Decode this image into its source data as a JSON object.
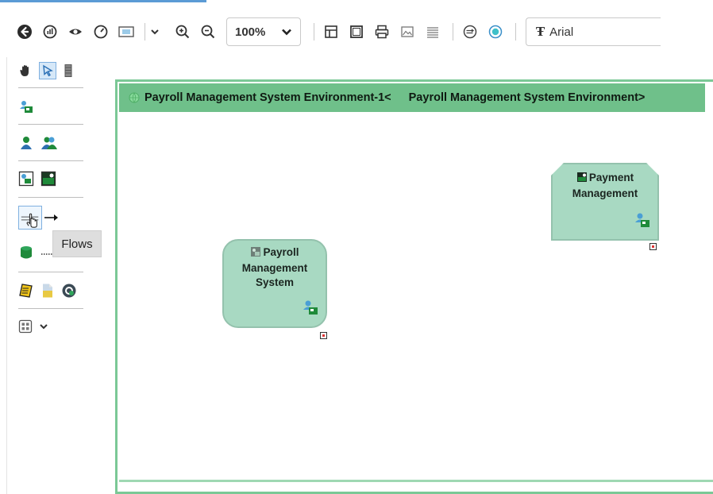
{
  "toolbar": {
    "zoom_value": "100%",
    "font_value": "Arial",
    "icons": [
      "back-icon",
      "chart-icon",
      "view-icon",
      "gauge-icon",
      "fit-screen-icon",
      "chevron-down-icon",
      "zoom-in-icon",
      "zoom-out-icon",
      "layout-icon",
      "frame-icon",
      "print-icon",
      "image-icon",
      "lines-icon",
      "export-icon",
      "refresh-icon",
      "font-icon"
    ]
  },
  "palette": {
    "tools": [
      "hand-icon",
      "select-arrow-icon",
      "column-icon",
      "component-icon",
      "person-icon",
      "people-icon",
      "app-icon",
      "app-dark-icon",
      "flow-icon",
      "arrow-icon",
      "database-icon",
      "dotted-line-icon",
      "note-icon",
      "document-icon",
      "gear-badge-icon",
      "grid-icon",
      "chevron-down-icon"
    ],
    "tooltip": "Flows"
  },
  "canvas": {
    "header_left": "Payroll Management System Environment-1<",
    "header_right": "Payroll Management System Environment>",
    "nodes": [
      {
        "label_line1": "Payroll",
        "label_line2": "Management",
        "label_line3": "System"
      },
      {
        "label_line1": "Payment",
        "label_line2": "Management"
      }
    ]
  },
  "colors": {
    "header_green": "#6fc08a",
    "node_fill": "#a8d9c2",
    "canvas_border": "#7bc896",
    "accent_blue": "#5b9bd5"
  }
}
